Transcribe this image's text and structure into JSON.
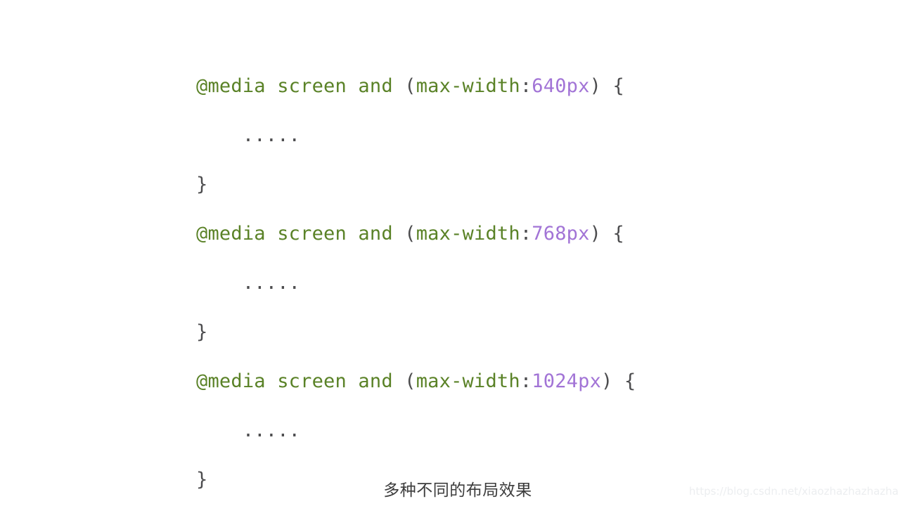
{
  "page": {
    "background_color": "#ffffff",
    "caption": "多种不同的布局效果",
    "watermark": "https://blog.csdn.net/xiaozhazhazhazha"
  },
  "theme": {
    "keyword_color": "#5a8227",
    "value_color": "#a274d6",
    "punctuation_color": "#4d4d4f",
    "caption_color": "#3c3c3c",
    "watermark_color": "#eceef0"
  },
  "code": {
    "language": "css",
    "lines": [
      {
        "id": "line-1",
        "type": "media-query-open",
        "at_rule": "@media",
        "media_type": "screen",
        "operator": "and",
        "open_paren": "(",
        "feature": "max-width",
        "colon": ":",
        "value": "640px",
        "close_paren": ")",
        "open_brace": "{"
      },
      {
        "id": "line-2",
        "type": "ellipsis",
        "indent": "    ",
        "text": "....."
      },
      {
        "id": "line-3",
        "type": "block-close",
        "text": "}"
      },
      {
        "id": "line-4",
        "type": "media-query-open",
        "at_rule": "@media",
        "media_type": "screen",
        "operator": "and",
        "open_paren": "(",
        "feature": "max-width",
        "colon": ":",
        "value": "768px",
        "close_paren": ")",
        "open_brace": "{"
      },
      {
        "id": "line-5",
        "type": "ellipsis",
        "indent": "    ",
        "text": "....."
      },
      {
        "id": "line-6",
        "type": "block-close",
        "text": "}"
      },
      {
        "id": "line-7",
        "type": "media-query-open",
        "at_rule": "@media",
        "media_type": "screen",
        "operator": "and",
        "open_paren": "(",
        "feature": "max-width",
        "colon": ":",
        "value": "1024px",
        "close_paren": ")",
        "open_brace": "{"
      },
      {
        "id": "line-8",
        "type": "ellipsis",
        "indent": "    ",
        "text": "....."
      },
      {
        "id": "line-9",
        "type": "block-close",
        "text": "}"
      }
    ]
  }
}
